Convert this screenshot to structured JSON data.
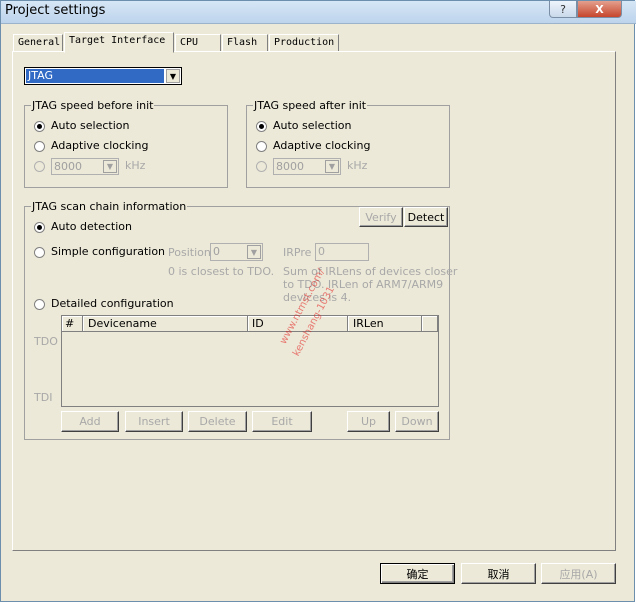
{
  "window": {
    "title": "Project settings",
    "help_label": "?",
    "close_label": "X"
  },
  "tabs": [
    {
      "label": "General",
      "active": false
    },
    {
      "label": "Target Interface",
      "active": true
    },
    {
      "label": "CPU",
      "active": false
    },
    {
      "label": "Flash",
      "active": false
    },
    {
      "label": "Production",
      "active": false
    }
  ],
  "interface_select": {
    "value": "JTAG"
  },
  "speed_before": {
    "legend": "JTAG speed before init",
    "auto_label": "Auto selection",
    "adaptive_label": "Adaptive clocking",
    "custom_value": "8000",
    "unit": "kHz"
  },
  "speed_after": {
    "legend": "JTAG speed after init",
    "auto_label": "Auto selection",
    "adaptive_label": "Adaptive clocking",
    "custom_value": "8000",
    "unit": "kHz"
  },
  "scan_chain": {
    "legend": "JTAG scan chain information",
    "verify_label": "Verify",
    "detect_label": "Detect",
    "auto_label": "Auto detection",
    "simple_label": "Simple configuration",
    "position_label": "Position",
    "position_value": "0",
    "position_hint": "0 is closest to TDO.",
    "irpre_label": "IRPre",
    "irpre_value": "0",
    "irpre_hint_1": "Sum of IRLens of devices closer",
    "irpre_hint_2": "to TDO. IRLen of ARM7/ARM9",
    "irpre_hint_3": "devices is 4.",
    "detailed_label": "Detailed configuration",
    "tdo_label": "TDO",
    "tdi_label": "TDI",
    "columns": [
      "#",
      "Devicename",
      "ID",
      "IRLen"
    ],
    "buttons": {
      "add": "Add",
      "insert": "Insert",
      "delete": "Delete",
      "edit": "Edit",
      "up": "Up",
      "down": "Down"
    }
  },
  "footer": {
    "ok": "确定",
    "cancel": "取消",
    "apply": "应用(A)"
  },
  "watermark": {
    "line1": "www.ntmst.com/",
    "line2": "kenshang-1031"
  },
  "colors": {
    "title_bar": "#bdd4ec",
    "selection": "#316ac5",
    "dialog_bg": "#ece9d8",
    "watermark": "#e61e1e"
  }
}
